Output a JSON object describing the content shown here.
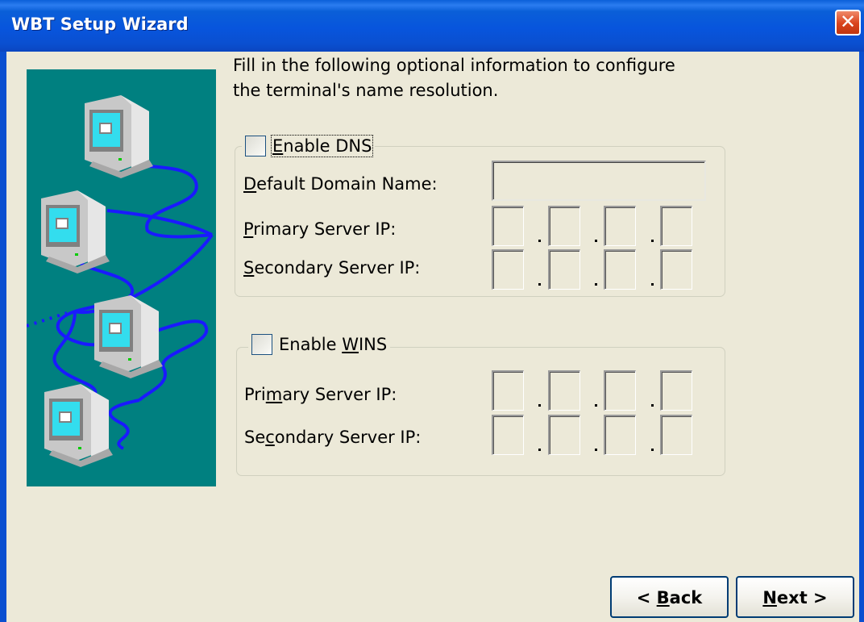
{
  "window": {
    "title": "WBT Setup Wizard",
    "close_icon": "close-icon",
    "close_glyph": "✕"
  },
  "illustration": {
    "icon": "networked-terminals-illustration"
  },
  "intro_text_line1": "Fill in the following optional information to configure",
  "intro_text_line2": "the terminal's name resolution.",
  "dns": {
    "checkbox_label_access_key": "E",
    "checkbox_label_rest": "nable DNS",
    "checked": false,
    "domain_label_key": "D",
    "domain_label_rest": "efault Domain Name:",
    "domain_value": "",
    "primary_label_key": "P",
    "primary_label_rest": "rimary Server IP:",
    "primary_ip": [
      "",
      "",
      "",
      ""
    ],
    "secondary_label_key": "S",
    "secondary_label_rest": "econdary Server IP:",
    "secondary_ip": [
      "",
      "",
      "",
      ""
    ]
  },
  "wins": {
    "checkbox_label_pre": "Enable ",
    "checkbox_label_access_key": "W",
    "checkbox_label_rest": "INS",
    "checked": false,
    "primary_label_pre": "Pri",
    "primary_label_key": "m",
    "primary_label_rest": "ary Server IP:",
    "primary_ip": [
      "",
      "",
      "",
      ""
    ],
    "secondary_label_pre": "Se",
    "secondary_label_key": "c",
    "secondary_label_rest": "ondary Server IP:",
    "secondary_ip": [
      "",
      "",
      "",
      ""
    ]
  },
  "buttons": {
    "back_pre": "< ",
    "back_key": "B",
    "back_rest": "ack",
    "next_key": "N",
    "next_rest": "ext >"
  }
}
